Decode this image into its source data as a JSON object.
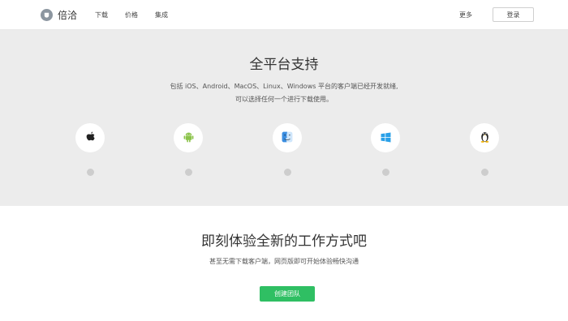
{
  "brand": {
    "name": "倍洽"
  },
  "nav": {
    "items": [
      "下载",
      "价格",
      "集成"
    ]
  },
  "header": {
    "more_label": "更多",
    "login_label": "登录"
  },
  "platforms": {
    "title": "全平台支持",
    "desc_line1": "包括 iOS、Android、MacOS、Linux、Windows 平台的客户端已经开发就绪,",
    "desc_line2": "可以选择任何一个进行下载使用。",
    "items": [
      {
        "name": "apple-icon"
      },
      {
        "name": "android-icon"
      },
      {
        "name": "finder-icon"
      },
      {
        "name": "windows-icon"
      },
      {
        "name": "linux-icon"
      }
    ]
  },
  "cta": {
    "title": "即刻体验全新的工作方式吧",
    "subtitle": "甚至无需下载客户端，网页版即可开始体验畅快沟通",
    "button_label": "创建团队"
  },
  "colors": {
    "accent_green": "#2fbf63",
    "section_gray": "#ececec",
    "android_green": "#8bc34a",
    "windows_blue": "#2aa0e8",
    "finder_blue": "#4a90d9"
  }
}
